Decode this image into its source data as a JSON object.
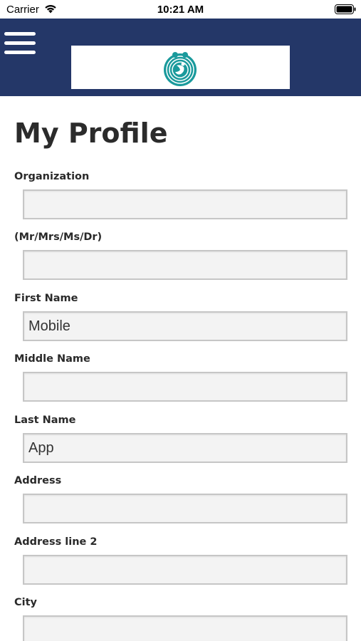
{
  "status_bar": {
    "carrier": "Carrier",
    "time": "10:21 AM"
  },
  "header": {
    "menu_icon": "hamburger-menu-icon",
    "logo_icon": "organization-logo",
    "background_color": "#243768"
  },
  "page": {
    "title": "My Profile"
  },
  "form": {
    "fields": [
      {
        "label": "Organization",
        "value": ""
      },
      {
        "label": "(Mr/Mrs/Ms/Dr)",
        "value": ""
      },
      {
        "label": "First Name",
        "value": "Mobile"
      },
      {
        "label": "Middle Name",
        "value": ""
      },
      {
        "label": "Last Name",
        "value": "App"
      },
      {
        "label": "Address",
        "value": ""
      },
      {
        "label": "Address line 2",
        "value": ""
      },
      {
        "label": "City",
        "value": ""
      }
    ]
  }
}
